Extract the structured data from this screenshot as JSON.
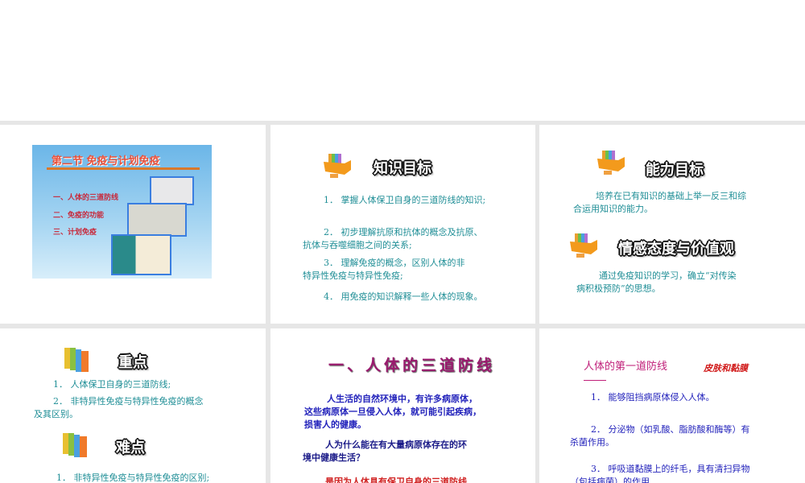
{
  "slides": [
    {
      "title": "第二节  免疫与计划免疫",
      "items": [
        "一、人体的三道防线",
        "二、免疫的功能",
        "三、计划免疫"
      ]
    },
    {
      "heading": "知识目标",
      "lines": [
        "1． 掌握人体保卫自身的三道防线的知识;",
        "2． 初步理解抗原和抗体的概念及抗原、",
        "抗体与吞噬细胞之间的关系;",
        "3． 理解免疫的概念，区别人体的非",
        "特异性免疫与特异性免疫;",
        "4． 用免疫的知识解释一些人体的现象。"
      ]
    },
    {
      "heading1": "能力目标",
      "text1": [
        "培养在已有知识的基础上举一反三和综",
        "合运用知识的能力。"
      ],
      "heading2": "情感态度与价值观",
      "text2": [
        "通过免疫知识的学习，确立“对传染",
        "病积极预防”的思想。"
      ]
    },
    {
      "heading1": "重点",
      "lines1": [
        "1． 人体保卫自身的三道防线;",
        "2． 非特异性免疫与特异性免疫的概念",
        "及其区别。"
      ],
      "heading2": "难点",
      "lines2": [
        "1． 非特异性免疫与特异性免疫的区别;"
      ]
    },
    {
      "title": "一、人体的三道防线",
      "para1": [
        "人生活的自然环境中，有许多病原体，",
        "这些病原体一旦侵入人体，就可能引起疾病，",
        "损害人的健康。"
      ],
      "para2": [
        "人为什么能在有大量病原体存在的环",
        "境中健康生活？"
      ],
      "para3": "是因为人体具有保卫自身的三道防线"
    },
    {
      "title": "人体的第一道防线",
      "subtitle": "皮肤和黏膜",
      "lines": [
        "1． 能够阻挡病原体侵入人体。",
        "2． 分泌物（如乳酸、脂肪酸和酶等）有",
        "杀菌作用。",
        "3． 呼吸道黏膜上的纤毛，具有清扫异物",
        "（包括病菌）的作用"
      ]
    }
  ]
}
